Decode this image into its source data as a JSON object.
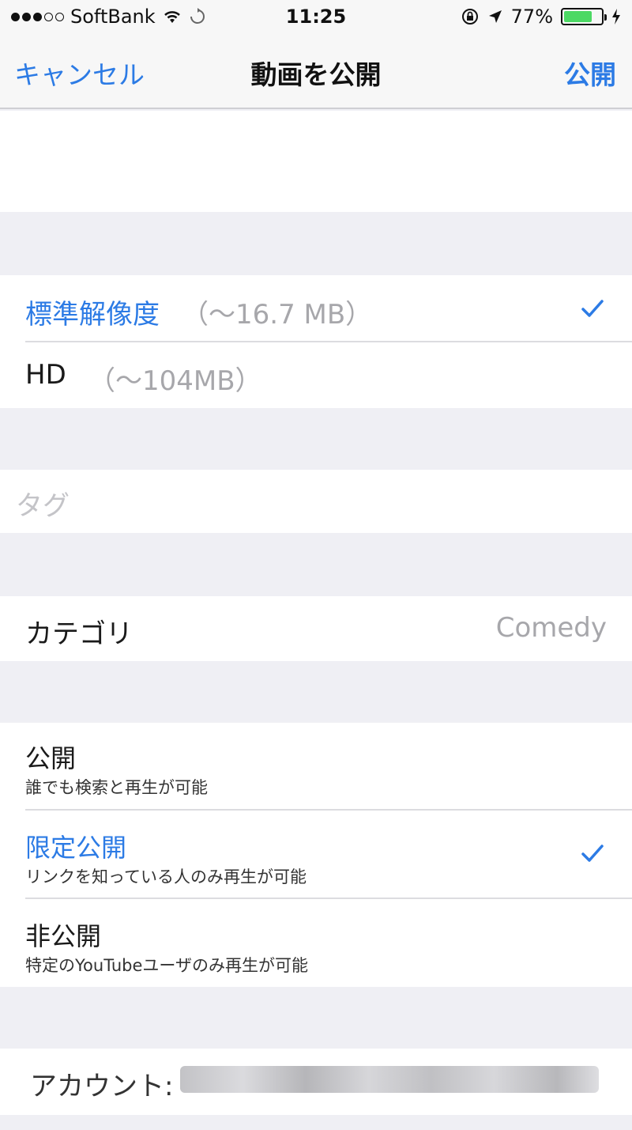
{
  "status_bar": {
    "carrier": "SoftBank",
    "time": "11:25",
    "battery_percent": "77%",
    "battery_level": 0.77,
    "icons": [
      "signal-dots-icon",
      "wifi-icon",
      "sync-icon",
      "lock-rotation-icon",
      "location-arrow-icon",
      "battery-icon",
      "charging-bolt-icon"
    ]
  },
  "navbar": {
    "cancel_label": "キャンセル",
    "title": "動画を公開",
    "publish_label": "公開"
  },
  "quality": {
    "options": [
      {
        "label": "標準解像度",
        "size": "（〜16.7 MB）",
        "selected": true
      },
      {
        "label": "HD",
        "size": "（〜104MB）",
        "selected": false
      }
    ]
  },
  "tags": {
    "placeholder": "タグ"
  },
  "category": {
    "label": "カテゴリ",
    "value": "Comedy"
  },
  "privacy": {
    "options": [
      {
        "label": "公開",
        "description": "誰でも検索と再生が可能",
        "selected": false
      },
      {
        "label": "限定公開",
        "description": "リンクを知っている人のみ再生が可能",
        "selected": true
      },
      {
        "label": "非公開",
        "description": "特定のYouTubeユーザのみ再生が可能",
        "selected": false
      }
    ]
  },
  "account": {
    "label": "アカウント:"
  },
  "colors": {
    "accent": "#2c7be5",
    "background": "#efeff4",
    "battery": "#4cd964"
  }
}
